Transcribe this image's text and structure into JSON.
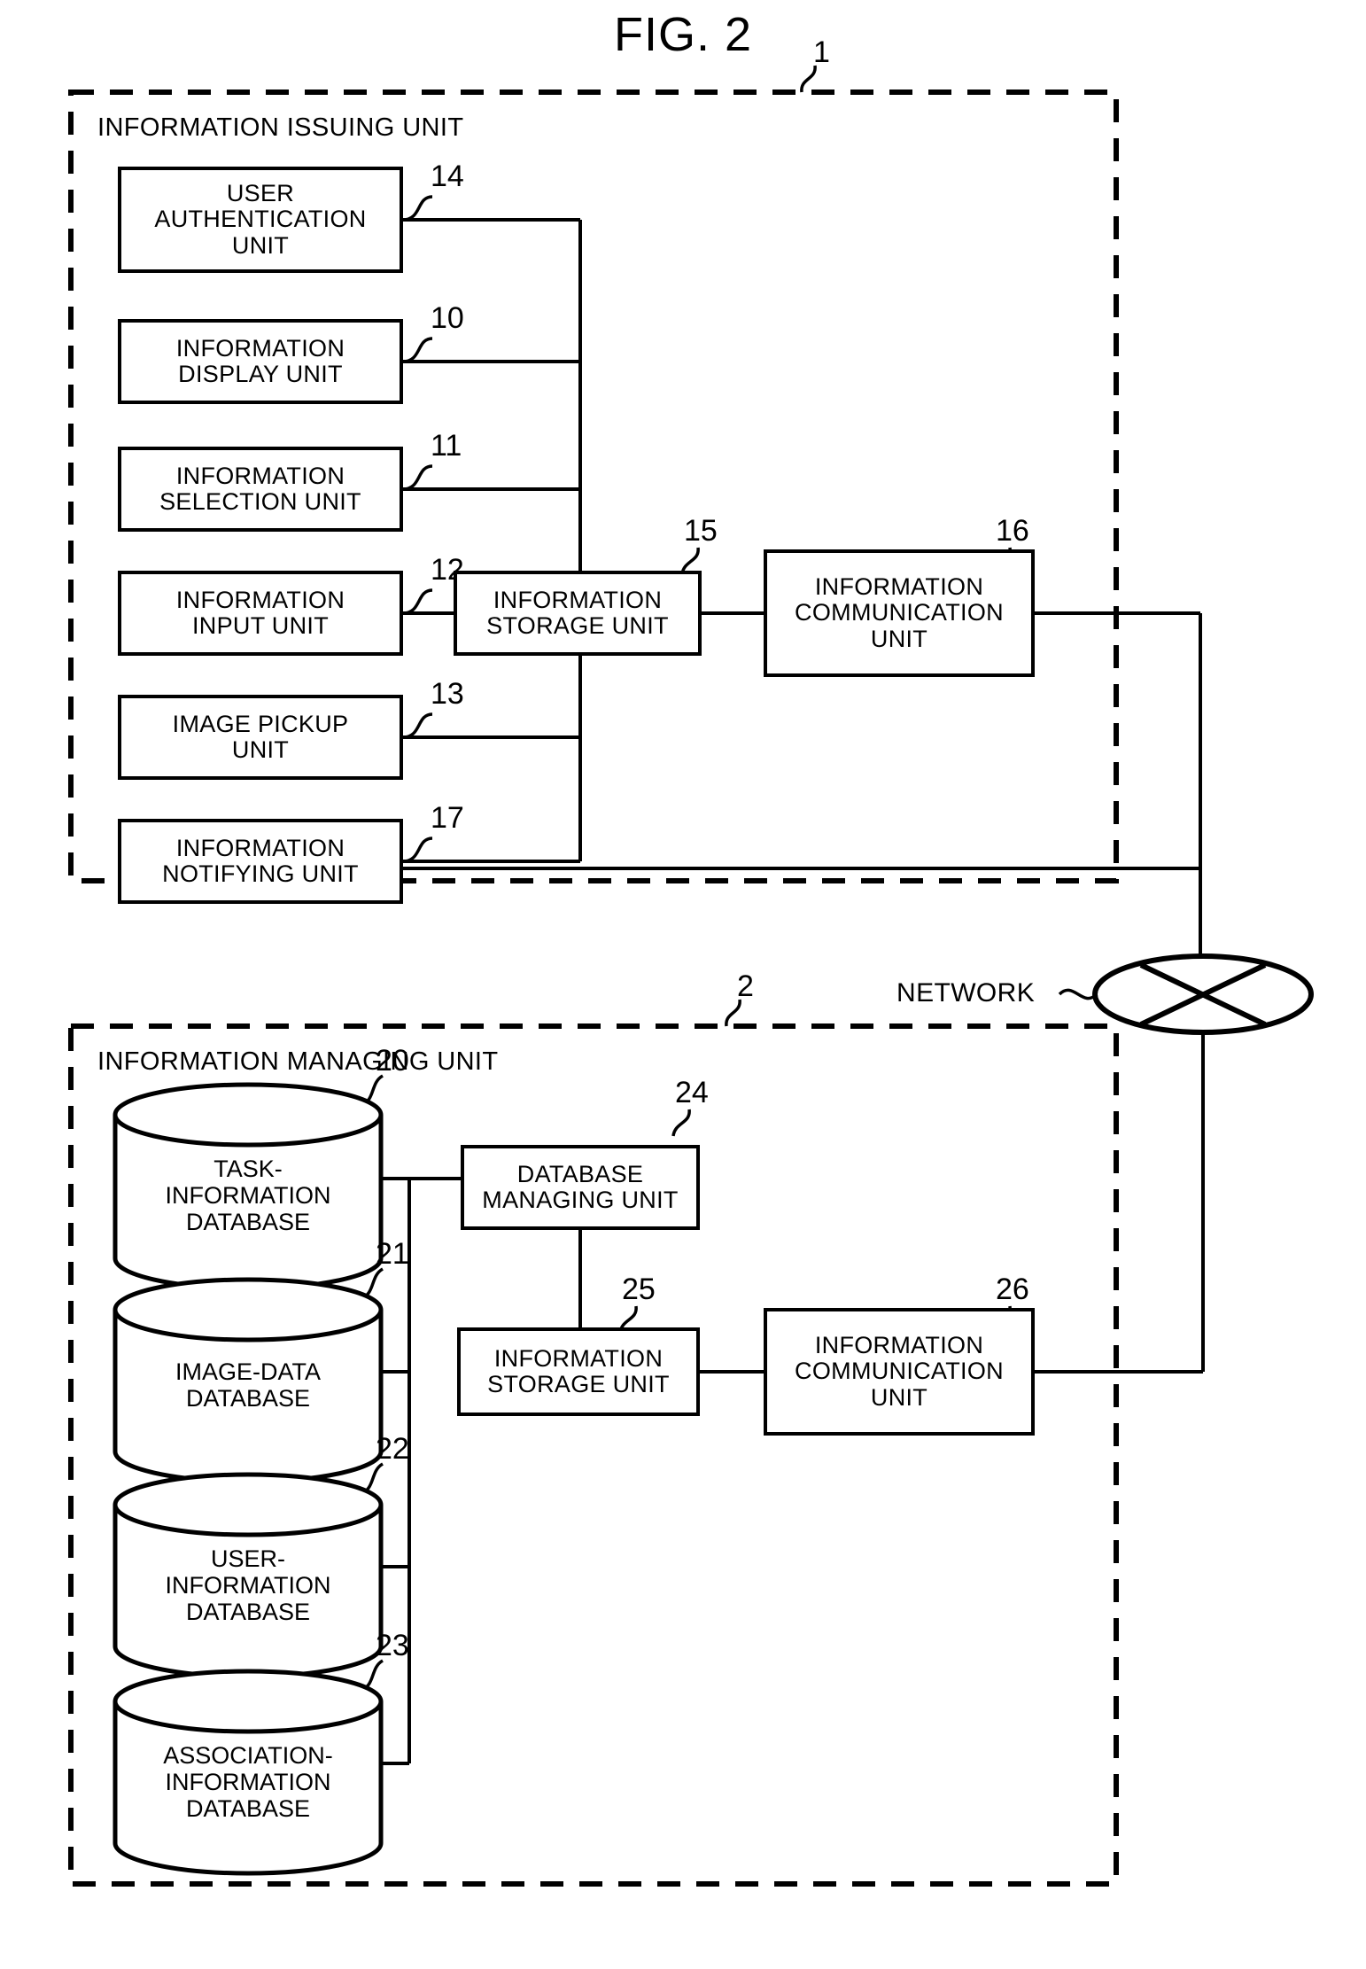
{
  "figure": {
    "title": "FIG. 2",
    "top_ref": "1",
    "bottom_ref": "2"
  },
  "network": {
    "label": "NETWORK",
    "symbol": "network-cloud-x-ellipse"
  },
  "issuing_unit": {
    "label": "INFORMATION ISSUING UNIT",
    "ref": "1",
    "boxes": [
      {
        "label": "USER\nAUTHENTICATION\nUNIT",
        "ref": "14"
      },
      {
        "label": "INFORMATION\nDISPLAY UNIT",
        "ref": "10"
      },
      {
        "label": "INFORMATION\nSELECTION UNIT",
        "ref": "11"
      },
      {
        "label": "INFORMATION\nINPUT UNIT",
        "ref": "12"
      },
      {
        "label": "IMAGE PICKUP\nUNIT",
        "ref": "13"
      },
      {
        "label": "INFORMATION\nNOTIFYING UNIT",
        "ref": "17"
      },
      {
        "label": "INFORMATION\nSTORAGE UNIT",
        "ref": "15"
      },
      {
        "label": "INFORMATION\nCOMMUNICATION\nUNIT",
        "ref": "16"
      }
    ]
  },
  "managing_unit": {
    "label": "INFORMATION MANAGING UNIT",
    "ref": "2",
    "databases": [
      {
        "label": "TASK-\nINFORMATION\nDATABASE",
        "ref": "20"
      },
      {
        "label": "IMAGE-DATA\nDATABASE",
        "ref": "21"
      },
      {
        "label": "USER-\nINFORMATION\nDATABASE",
        "ref": "22"
      },
      {
        "label": "ASSOCIATION-\nINFORMATION\nDATABASE",
        "ref": "23"
      }
    ],
    "boxes": [
      {
        "label": "DATABASE\nMANAGING UNIT",
        "ref": "24"
      },
      {
        "label": "INFORMATION\nSTORAGE UNIT",
        "ref": "25"
      },
      {
        "label": "INFORMATION\nCOMMUNICATION\nUNIT",
        "ref": "26"
      }
    ]
  },
  "colors": {
    "ink": "#000000",
    "paper": "#ffffff"
  }
}
